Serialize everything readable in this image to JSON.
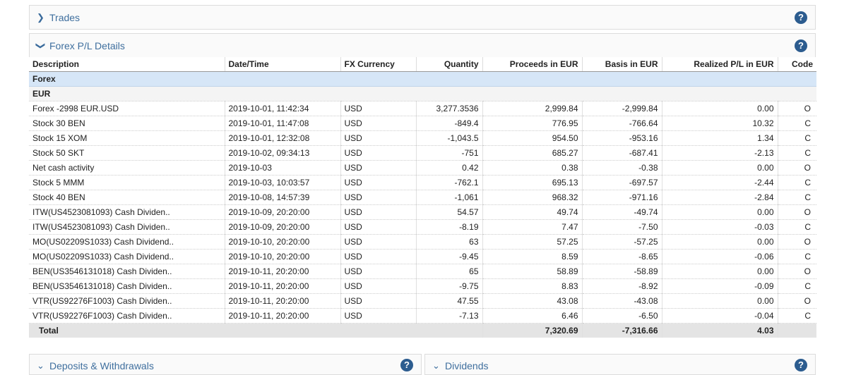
{
  "panels": {
    "trades": {
      "title": "Trades",
      "help": "?"
    },
    "forex": {
      "title": "Forex P/L Details",
      "help": "?"
    },
    "deposits": {
      "title": "Deposits & Withdrawals",
      "help": "?"
    },
    "dividends": {
      "title": "Dividends",
      "help": "?"
    }
  },
  "table": {
    "headers": [
      "Description",
      "Date/Time",
      "FX Currency",
      "Quantity",
      "Proceeds in EUR",
      "Basis in EUR",
      "Realized P/L in EUR",
      "Code"
    ],
    "section": "Forex",
    "currency": "EUR",
    "rows": [
      [
        "Forex -2998 EUR.USD",
        "2019-10-01, 11:42:34",
        "USD",
        "3,277.3536",
        "2,999.84",
        "-2,999.84",
        "0.00",
        "O"
      ],
      [
        "Stock 30 BEN",
        "2019-10-01, 11:47:08",
        "USD",
        "-849.4",
        "776.95",
        "-766.64",
        "10.32",
        "C"
      ],
      [
        "Stock 15 XOM",
        "2019-10-01, 12:32:08",
        "USD",
        "-1,043.5",
        "954.50",
        "-953.16",
        "1.34",
        "C"
      ],
      [
        "Stock 50 SKT",
        "2019-10-02, 09:34:13",
        "USD",
        "-751",
        "685.27",
        "-687.41",
        "-2.13",
        "C"
      ],
      [
        "Net cash activity",
        "2019-10-03",
        "USD",
        "0.42",
        "0.38",
        "-0.38",
        "0.00",
        "O"
      ],
      [
        "Stock 5 MMM",
        "2019-10-03, 10:03:57",
        "USD",
        "-762.1",
        "695.13",
        "-697.57",
        "-2.44",
        "C"
      ],
      [
        "Stock 40 BEN",
        "2019-10-08, 14:57:39",
        "USD",
        "-1,061",
        "968.32",
        "-971.16",
        "-2.84",
        "C"
      ],
      [
        "ITW(US4523081093) Cash Dividen..",
        "2019-10-09, 20:20:00",
        "USD",
        "54.57",
        "49.74",
        "-49.74",
        "0.00",
        "O"
      ],
      [
        "ITW(US4523081093) Cash Dividen..",
        "2019-10-09, 20:20:00",
        "USD",
        "-8.19",
        "7.47",
        "-7.50",
        "-0.03",
        "C"
      ],
      [
        "MO(US02209S1033) Cash Dividend..",
        "2019-10-10, 20:20:00",
        "USD",
        "63",
        "57.25",
        "-57.25",
        "0.00",
        "O"
      ],
      [
        "MO(US02209S1033) Cash Dividend..",
        "2019-10-10, 20:20:00",
        "USD",
        "-9.45",
        "8.59",
        "-8.65",
        "-0.06",
        "C"
      ],
      [
        "BEN(US3546131018) Cash Dividen..",
        "2019-10-11, 20:20:00",
        "USD",
        "65",
        "58.89",
        "-58.89",
        "0.00",
        "O"
      ],
      [
        "BEN(US3546131018) Cash Dividen..",
        "2019-10-11, 20:20:00",
        "USD",
        "-9.75",
        "8.83",
        "-8.92",
        "-0.09",
        "C"
      ],
      [
        "VTR(US92276F1003) Cash Dividen..",
        "2019-10-11, 20:20:00",
        "USD",
        "47.55",
        "43.08",
        "-43.08",
        "0.00",
        "O"
      ],
      [
        "VTR(US92276F1003) Cash Dividen..",
        "2019-10-11, 20:20:00",
        "USD",
        "-7.13",
        "6.46",
        "-6.50",
        "-0.04",
        "C"
      ]
    ],
    "total": {
      "label": "Total",
      "proceeds": "7,320.69",
      "basis": "-7,316.66",
      "pl": "4.03"
    }
  }
}
